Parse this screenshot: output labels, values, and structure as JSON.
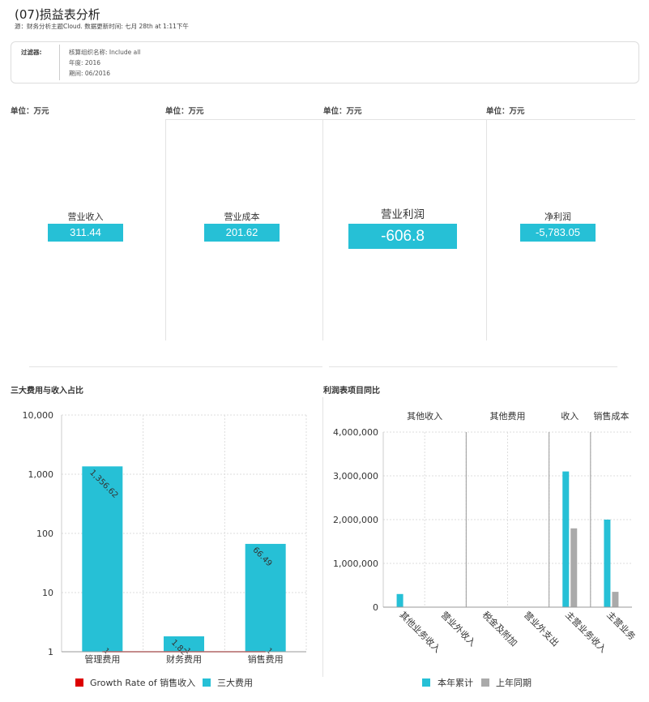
{
  "header": {
    "title": "(07)损益表分析",
    "subtitle": "源：财务分析主题Cloud. 数据更新时间: 七月 28th at 1:11下午"
  },
  "filters": {
    "label": "过滤器:",
    "lines": [
      "核算组织名称: Include all",
      "年度: 2016",
      "期间: 06/2016"
    ]
  },
  "kpis": [
    {
      "unit": "单位：万元",
      "title": "营业收入",
      "value": "311.44"
    },
    {
      "unit": "单位：万元",
      "title": "营业成本",
      "value": "201.62"
    },
    {
      "unit": "单位：万元",
      "title": "营业利润",
      "value": "-606.8"
    },
    {
      "unit": "单位：万元",
      "title": "净利润",
      "value": "-5,783.05"
    }
  ],
  "colors": {
    "accent": "#26c0d6",
    "line": "#dd0000",
    "prior": "#aaaaaa"
  },
  "chart_data": [
    {
      "type": "bar",
      "title": "三大费用与收入占比",
      "yscale": "log",
      "ylim": [
        1,
        10000
      ],
      "yticks": [
        "1",
        "10",
        "100",
        "1,000",
        "10,000"
      ],
      "categories": [
        "管理费用",
        "财务费用",
        "销售费用"
      ],
      "series": [
        {
          "name": "三大费用",
          "type": "bar",
          "values": [
            1356.62,
            1.82,
            66.49
          ],
          "labels": [
            "1,356.62",
            "1.82",
            "66.49"
          ]
        },
        {
          "name": "Growth Rate of 销售收入",
          "type": "line",
          "values": [
            1,
            1,
            1
          ],
          "labels": [
            "1",
            "1",
            "1"
          ]
        }
      ],
      "grid": true,
      "legend": "bottom"
    },
    {
      "type": "bar",
      "title": "利润表项目同比",
      "ylim": [
        0,
        4000000
      ],
      "yticks": [
        "0",
        "1,000,000",
        "2,000,000",
        "3,000,000",
        "4,000,000"
      ],
      "groups": [
        {
          "label": "其他收入",
          "categories": [
            "其他业务收入",
            "营业外收入"
          ]
        },
        {
          "label": "其他费用",
          "categories": [
            "税金及附加",
            "营业外支出"
          ]
        },
        {
          "label": "收入",
          "categories": [
            "主营业务收入"
          ]
        },
        {
          "label": "销售成本",
          "categories": [
            "主营业务成本"
          ]
        }
      ],
      "category_labels": [
        "其他业务收入",
        "营业外收入",
        "税金及附加",
        "营业外支出",
        "主营业务收入",
        "主营业务"
      ],
      "series": [
        {
          "name": "本年累计",
          "values": [
            300000,
            0,
            0,
            0,
            3100000,
            2000000
          ]
        },
        {
          "name": "上年同期",
          "values": [
            0,
            0,
            0,
            0,
            1800000,
            350000
          ]
        }
      ],
      "grid": true,
      "legend": "bottom"
    }
  ]
}
